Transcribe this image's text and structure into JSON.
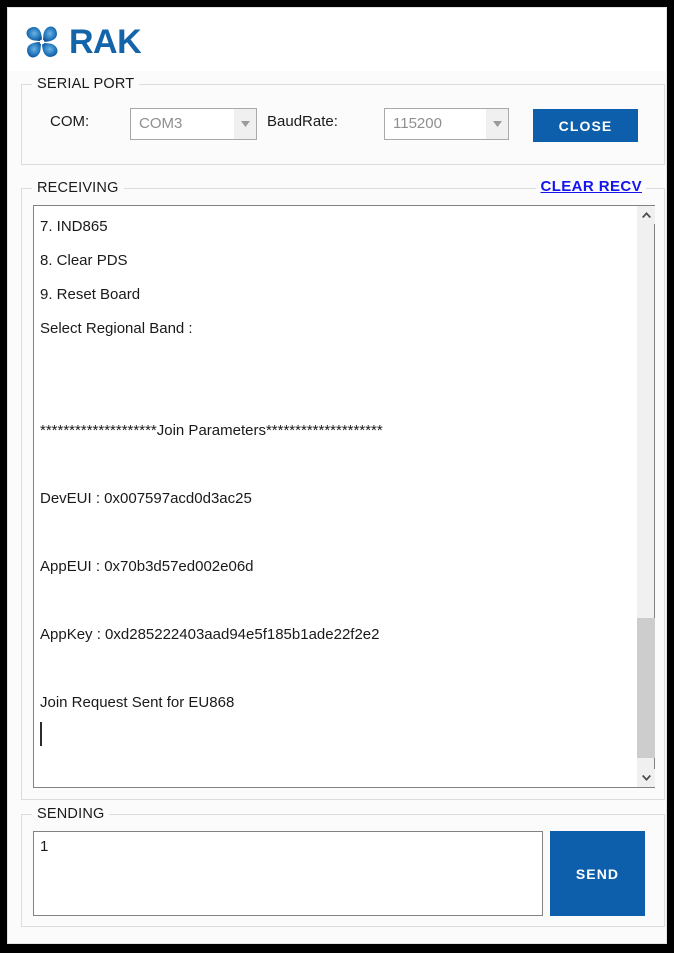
{
  "app": {
    "logo_text": "RAK",
    "logo_icon": "rak-pinwheel-icon",
    "brand_color": "#1464aa",
    "accent_color": "#0d5fac",
    "link_color": "#1414ee"
  },
  "serial_port": {
    "title": "SERIAL PORT",
    "com_label": "COM:",
    "com_value": "COM3",
    "com_placeholder": "COM3",
    "baud_label": "BaudRate:",
    "baud_value": "115200",
    "baud_placeholder": "115200",
    "close_button": "CLOSE"
  },
  "receiving": {
    "title": "RECEIVING",
    "clear_link": "CLEAR RECV",
    "lines": [
      "7. IND865",
      "8. Clear PDS",
      "9. Reset Board",
      "Select Regional Band :",
      "",
      "",
      "********************Join Parameters********************",
      "",
      "DevEUI : 0x007597acd0d3ac25",
      "",
      "AppEUI : 0x70b3d57ed002e06d",
      "",
      "AppKey : 0xd285222403aad94e5f185b1ade22f2e2",
      "",
      "Join Request Sent for EU868",
      ""
    ],
    "scrollbar": {
      "up_icon": "chevron-up-icon",
      "down_icon": "chevron-down-icon",
      "thumb_position": "near-bottom"
    }
  },
  "sending": {
    "title": "SENDING",
    "input_value": "1",
    "input_placeholder": "",
    "send_button": "SEND"
  }
}
